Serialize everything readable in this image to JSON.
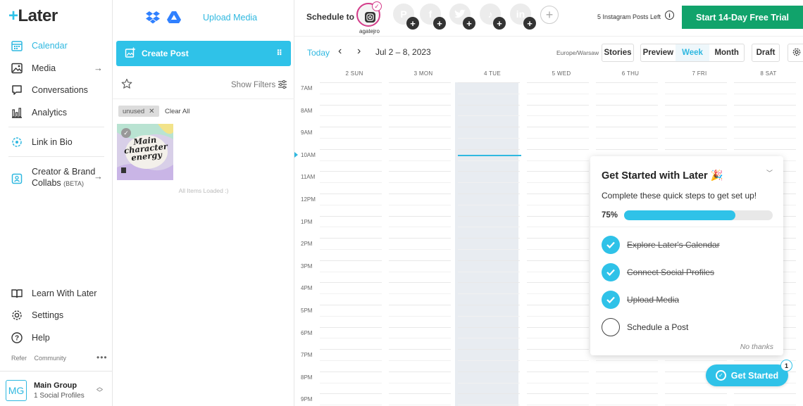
{
  "brand": {
    "name": "Later",
    "accent": "#2fc2e8"
  },
  "sidebar": {
    "items": [
      {
        "label": "Calendar",
        "icon": "calendar-icon",
        "active": true
      },
      {
        "label": "Media",
        "icon": "image-icon"
      },
      {
        "label": "Conversations",
        "icon": "chat-icon"
      },
      {
        "label": "Analytics",
        "icon": "bar-chart-icon"
      },
      {
        "label": "Link in Bio",
        "icon": "link-in-bio-icon"
      },
      {
        "label": "Creator & Brand",
        "label2": "Collabs",
        "badge": "(BETA)",
        "icon": "collab-icon"
      },
      {
        "label": "Learn With Later",
        "icon": "book-icon"
      },
      {
        "label": "Settings",
        "icon": "gear-icon"
      },
      {
        "label": "Help",
        "icon": "help-icon"
      }
    ],
    "refer": "Refer",
    "community": "Community",
    "more": "•••",
    "group": {
      "avatar": "MG",
      "name": "Main Group",
      "profiles": "1 Social Profiles"
    }
  },
  "media_panel": {
    "upload_label": "Upload Media",
    "create_post": "Create Post",
    "show_filters": "Show Filters",
    "filter_chip": "unused",
    "clear_all": "Clear All",
    "thumb_text": [
      "Main",
      "character",
      "energy"
    ],
    "all_loaded": "All Items Loaded :)"
  },
  "topbar": {
    "schedule_to": "Schedule to",
    "profile_name": "agatejro",
    "posts_left": "5 Instagram Posts Left",
    "trial_button": "Start 14-Day Free Trial",
    "trial_color": "#11a36b"
  },
  "toolbar": {
    "today": "Today",
    "range": "Jul 2 – 8, 2023",
    "timezone": "Europe/Warsaw",
    "stories": "Stories",
    "preview": "Preview",
    "week": "Week",
    "month": "Month",
    "draft": "Draft"
  },
  "calendar": {
    "days": [
      "2 SUN",
      "3 MON",
      "4 TUE",
      "5 WED",
      "6 THU",
      "7 FRI",
      "8 SAT"
    ],
    "highlighted_day": "4 TUE",
    "hours": [
      "7AM",
      "8AM",
      "9AM",
      "10AM",
      "11AM",
      "12PM",
      "1PM",
      "2PM",
      "3PM",
      "4PM",
      "5PM",
      "6PM",
      "7PM",
      "8PM",
      "9PM"
    ]
  },
  "get_started": {
    "title": "Get Started with Later",
    "subtitle": "Complete these quick steps to get set up!",
    "progress_label": "75%",
    "progress": 0.75,
    "steps": [
      {
        "label": "Explore Later's Calendar",
        "done": true
      },
      {
        "label": "Connect Social Profiles",
        "done": true
      },
      {
        "label": "Upload Media",
        "done": true
      },
      {
        "label": "Schedule a Post",
        "done": false
      }
    ],
    "no_thanks": "No thanks",
    "button": "Get Started",
    "badge": "1"
  }
}
